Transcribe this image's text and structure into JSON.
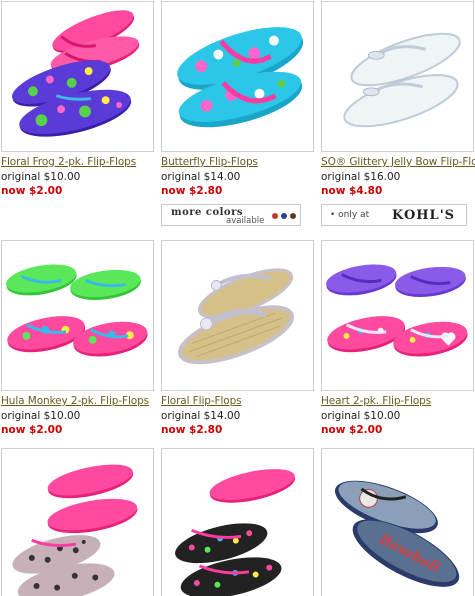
{
  "products": [
    {
      "title": "Floral Frog 2-pk. Flip-Flops",
      "original": "original $10.00",
      "now": "now $2.00"
    },
    {
      "title": "Butterfly Flip-Flops",
      "original": "original $14.00",
      "now": "now $2.80"
    },
    {
      "title": "SO® Glittery Jelly Bow Flip-Flops",
      "original": "original $16.00",
      "now": "now $4.80"
    },
    {
      "title": "Hula Monkey 2-pk. Flip-Flops",
      "original": "original $10.00",
      "now": "now $2.00"
    },
    {
      "title": "Floral Flip-Flops",
      "original": "original $14.00",
      "now": "now $2.80"
    },
    {
      "title": "Heart 2-pk. Flip-Flops",
      "original": "original $10.00",
      "now": "now $2.00"
    }
  ],
  "badges": {
    "more_colors_line1": "more colors",
    "more_colors_line2": "available",
    "more_colors_dots": [
      "#c0392b",
      "#2c3e8f",
      "#5a3b1a"
    ],
    "only_at": "• only at",
    "store": "KOHL'S"
  },
  "images": {
    "baseball_text": "Baseball"
  },
  "colors": {
    "title_link": "#6b5a1f",
    "sale_price": "#cc0000",
    "border": "#cfcfcf"
  }
}
